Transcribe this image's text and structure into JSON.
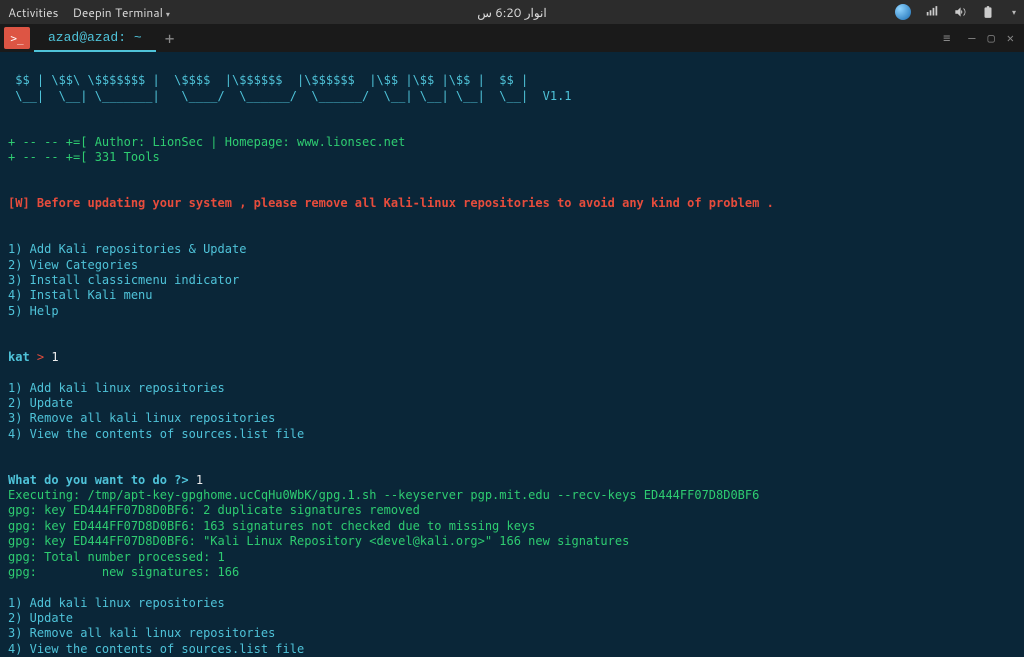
{
  "topbar": {
    "activities": "Activities",
    "appmenu": "Deepin Terminal",
    "clock": "انوار  6:20 س"
  },
  "tabbar": {
    "appicon_glyph": ">_",
    "tab_title": "azad@azad: ~",
    "newtab": "+",
    "menu_glyph": "≡",
    "min": "—",
    "max": "▢",
    "close": "✕"
  },
  "term": {
    "ascii1": " $$ | \\$$\\ \\$$$$$$$ |  \\$$$$  |\\$$$$$$  |\\$$$$$$  |\\$$ |\\$$ |\\$$ |  $$ |",
    "ascii2": " \\__|  \\__| \\_______|   \\____/  \\______/  \\______/  \\__| \\__| \\__|  \\__|  V1.1",
    "info1": "+ -- -- +=[ Author: LionSec | Homepage: www.lionsec.net",
    "info2": "+ -- -- +=[ 331 Tools",
    "warn": "[W] Before updating your system , please remove all Kali-linux repositories to avoid any kind of problem .",
    "menuA": [
      "1) Add Kali repositories & Update",
      "2) View Categories",
      "3) Install classicmenu indicator",
      "4) Install Kali menu",
      "5) Help"
    ],
    "prompt1_label": "kat",
    "prompt1_gt": " > ",
    "prompt1_val": "1",
    "menuB": [
      "1) Add kali linux repositories",
      "2) Update",
      "3) Remove all kali linux repositories",
      "4) View the contents of sources.list file"
    ],
    "prompt2_label": "What do you want to do ?>",
    "prompt2_val": " 1",
    "gpg": [
      "Executing: /tmp/apt-key-gpghome.ucCqHu0WbK/gpg.1.sh --keyserver pgp.mit.edu --recv-keys ED444FF07D8D0BF6",
      "gpg: key ED444FF07D8D0BF6: 2 duplicate signatures removed",
      "gpg: key ED444FF07D8D0BF6: 163 signatures not checked due to missing keys",
      "gpg: key ED444FF07D8D0BF6: \"Kali Linux Repository <devel@kali.org>\" 166 new signatures",
      "gpg: Total number processed: 1",
      "gpg:         new signatures: 166"
    ],
    "menuC": [
      "1) Add kali linux repositories",
      "2) Update",
      "3) Remove all kali linux repositories",
      "4) View the contents of sources.list file"
    ]
  }
}
